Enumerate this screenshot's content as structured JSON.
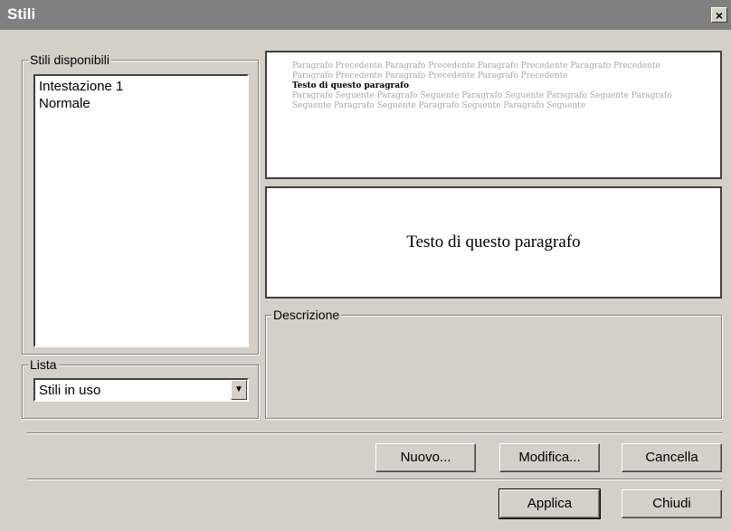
{
  "window": {
    "title": "Stili",
    "close_symbol": "×"
  },
  "styles_group": {
    "label": "Stili disponibili",
    "items": [
      "Intestazione 1",
      "Normale"
    ]
  },
  "list_group": {
    "label": "Lista",
    "selected": "Stili in uso"
  },
  "preview": {
    "previous_text": "Paragrafo Precedente Paragrafo Precedente Paragrafo Precedente Paragrafo Precedente Paragrafo Precedente Paragrafo Precedente Paragrafo Precedente",
    "current_text": "Testo di questo paragrafo",
    "following_text": "Paragrafo Seguente Paragrafo Seguente Paragrafo Seguente Paragrafo Seguente Paragrafo Seguente Paragrafo Seguente Paragrafo Seguente Paragrafo Seguente",
    "font_sample": "Testo di questo paragrafo"
  },
  "description_group": {
    "label": "Descrizione"
  },
  "buttons": {
    "new": "Nuovo...",
    "modify": "Modifica...",
    "delete": "Cancella",
    "apply": "Applica",
    "close": "Chiudi"
  }
}
